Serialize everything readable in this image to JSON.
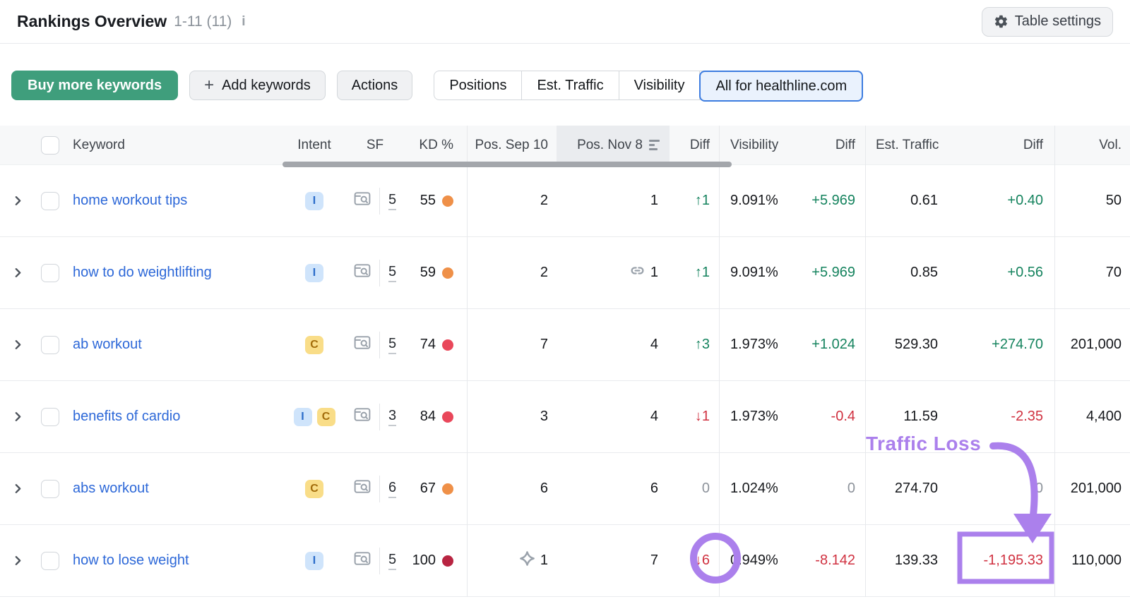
{
  "header": {
    "title": "Rankings Overview",
    "range": "1-11 (11)",
    "info_icon": "i",
    "table_settings_label": "Table settings"
  },
  "toolbar": {
    "buy_label": "Buy more keywords",
    "plus": "+",
    "add_label": "Add keywords",
    "actions_label": "Actions",
    "tabs": [
      {
        "label": "Positions",
        "active": false
      },
      {
        "label": "Est. Traffic",
        "active": false
      },
      {
        "label": "Visibility",
        "active": false
      },
      {
        "label": "All for healthline.com",
        "active": true
      }
    ]
  },
  "table": {
    "columns": {
      "keyword": "Keyword",
      "intent": "Intent",
      "sf": "SF",
      "kd": "KD %",
      "pos_sep": "Pos. Sep 10",
      "pos_nov": "Pos. Nov 8",
      "diff": "Diff",
      "visibility": "Visibility",
      "vis_diff": "Diff",
      "est_traffic": "Est. Traffic",
      "traffic_diff": "Diff",
      "vol": "Vol."
    },
    "rows": [
      {
        "keyword": "home workout tips",
        "intents": [
          "I"
        ],
        "sf": "5",
        "kd": "55",
        "kd_level": "orange",
        "pos_sep": "2",
        "pos_sep_icon": null,
        "pos_nov": "1",
        "pos_nov_icon": null,
        "diff": "↑1",
        "diff_tone": "up",
        "diff_circled": false,
        "visibility": "9.091%",
        "vis_diff": "+5.969",
        "vis_diff_tone": "up",
        "est_traffic": "0.61",
        "traffic_diff": "+0.40",
        "traffic_diff_tone": "up",
        "traffic_diff_boxed": false,
        "vol": "50"
      },
      {
        "keyword": "how to do weightlifting",
        "intents": [
          "I"
        ],
        "sf": "5",
        "kd": "59",
        "kd_level": "orange",
        "pos_sep": "2",
        "pos_sep_icon": null,
        "pos_nov": "1",
        "pos_nov_icon": "link-icon",
        "diff": "↑1",
        "diff_tone": "up",
        "diff_circled": false,
        "visibility": "9.091%",
        "vis_diff": "+5.969",
        "vis_diff_tone": "up",
        "est_traffic": "0.85",
        "traffic_diff": "+0.56",
        "traffic_diff_tone": "up",
        "traffic_diff_boxed": false,
        "vol": "70"
      },
      {
        "keyword": "ab workout",
        "intents": [
          "C"
        ],
        "sf": "5",
        "kd": "74",
        "kd_level": "red",
        "pos_sep": "7",
        "pos_sep_icon": null,
        "pos_nov": "4",
        "pos_nov_icon": null,
        "diff": "↑3",
        "diff_tone": "up",
        "diff_circled": false,
        "visibility": "1.973%",
        "vis_diff": "+1.024",
        "vis_diff_tone": "up",
        "est_traffic": "529.30",
        "traffic_diff": "+274.70",
        "traffic_diff_tone": "up",
        "traffic_diff_boxed": false,
        "vol": "201,000"
      },
      {
        "keyword": "benefits of cardio",
        "intents": [
          "I",
          "C"
        ],
        "sf": "3",
        "kd": "84",
        "kd_level": "red",
        "pos_sep": "3",
        "pos_sep_icon": null,
        "pos_nov": "4",
        "pos_nov_icon": null,
        "diff": "↓1",
        "diff_tone": "down",
        "diff_circled": false,
        "visibility": "1.973%",
        "vis_diff": "-0.4",
        "vis_diff_tone": "down",
        "est_traffic": "11.59",
        "traffic_diff": "-2.35",
        "traffic_diff_tone": "down",
        "traffic_diff_boxed": false,
        "vol": "4,400"
      },
      {
        "keyword": "abs workout",
        "intents": [
          "C"
        ],
        "sf": "6",
        "kd": "67",
        "kd_level": "orange",
        "pos_sep": "6",
        "pos_sep_icon": null,
        "pos_nov": "6",
        "pos_nov_icon": null,
        "diff": "0",
        "diff_tone": "zero",
        "diff_circled": false,
        "visibility": "1.024%",
        "vis_diff": "0",
        "vis_diff_tone": "zero",
        "est_traffic": "274.70",
        "traffic_diff": "0",
        "traffic_diff_tone": "zero",
        "traffic_diff_boxed": false,
        "vol": "201,000"
      },
      {
        "keyword": "how to lose weight",
        "intents": [
          "I"
        ],
        "sf": "5",
        "kd": "100",
        "kd_level": "crimson",
        "pos_sep": "1",
        "pos_sep_icon": "featured-snippet-icon",
        "pos_nov": "7",
        "pos_nov_icon": null,
        "diff": "↓6",
        "diff_tone": "down",
        "diff_circled": true,
        "visibility": "0.949%",
        "vis_diff": "-8.142",
        "vis_diff_tone": "down",
        "est_traffic": "139.33",
        "traffic_diff": "-1,195.33",
        "traffic_diff_tone": "down",
        "traffic_diff_boxed": true,
        "vol": "110,000"
      }
    ]
  },
  "annotation": {
    "label": "Traffic Loss"
  },
  "colors": {
    "accent_green": "#3f9e7c",
    "link_blue": "#2d68d8",
    "diff_up": "#15835e",
    "diff_down": "#d03140",
    "diff_zero": "#8d939b",
    "kd_orange": "#ef9048",
    "kd_red": "#e9475a",
    "kd_crimson": "#b82441",
    "annotation_purple": "#ab80ec",
    "tab_active_border": "#3c7ce0",
    "tab_active_bg": "#eaf2fd",
    "intent_i_bg": "#cfe4fb",
    "intent_i_text": "#2a6bc9",
    "intent_c_bg": "#f9dd88",
    "intent_c_text": "#a36d0c"
  }
}
